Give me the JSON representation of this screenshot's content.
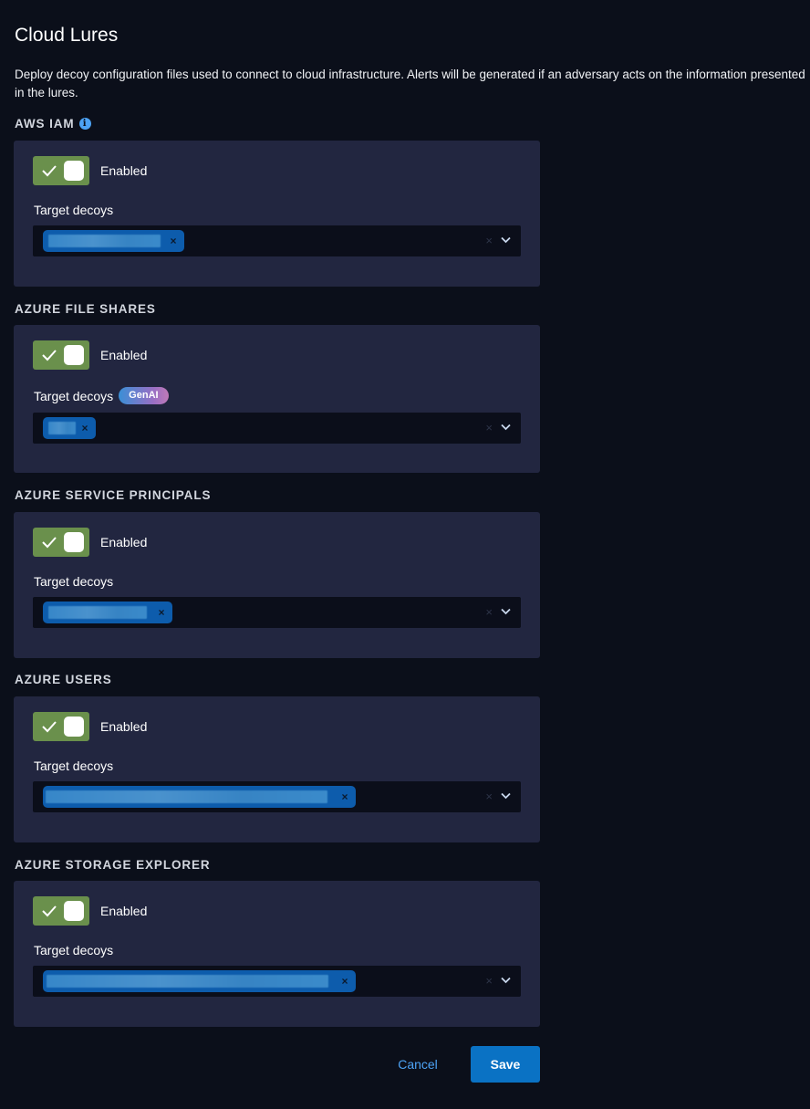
{
  "page": {
    "title": "Cloud Lures",
    "description": "Deploy decoy configuration files used to connect to cloud infrastructure. Alerts will be generated if an adversary acts on the information presented in the lures."
  },
  "colors": {
    "toggle_on": "#6a904c",
    "card_bg": "#222640",
    "chip_bg": "#0d5cac",
    "accent": "#4da3f5",
    "save_button": "#0a72c4"
  },
  "sections": [
    {
      "title": "AWS IAM",
      "info_icon": "info-icon",
      "toggle": {
        "state": "on",
        "label": "Enabled"
      },
      "field_label": "Target decoys",
      "badge": "",
      "chips": [
        {
          "value": "[redacted]",
          "remove": "×"
        }
      ],
      "clear": "×"
    },
    {
      "title": "AZURE FILE SHARES",
      "toggle": {
        "state": "on",
        "label": "Enabled"
      },
      "field_label": "Target decoys",
      "badge": "GenAI",
      "chips": [
        {
          "value": "[redacted]",
          "remove": "×"
        }
      ],
      "clear": "×"
    },
    {
      "title": "AZURE SERVICE PRINCIPALS",
      "toggle": {
        "state": "on",
        "label": "Enabled"
      },
      "field_label": "Target decoys",
      "badge": "",
      "chips": [
        {
          "value": "[redacted]",
          "remove": "×"
        }
      ],
      "clear": "×"
    },
    {
      "title": "AZURE USERS",
      "toggle": {
        "state": "on",
        "label": "Enabled"
      },
      "field_label": "Target decoys",
      "badge": "",
      "chips": [
        {
          "value": "[redacted]",
          "remove": "×"
        }
      ],
      "clear": "×"
    },
    {
      "title": "AZURE STORAGE EXPLORER",
      "toggle": {
        "state": "on",
        "label": "Enabled"
      },
      "field_label": "Target decoys",
      "badge": "",
      "chips": [
        {
          "value": "[redacted]",
          "remove": "×"
        }
      ],
      "clear": "×"
    }
  ],
  "actions": {
    "cancel_label": "Cancel",
    "save_label": "Save"
  }
}
